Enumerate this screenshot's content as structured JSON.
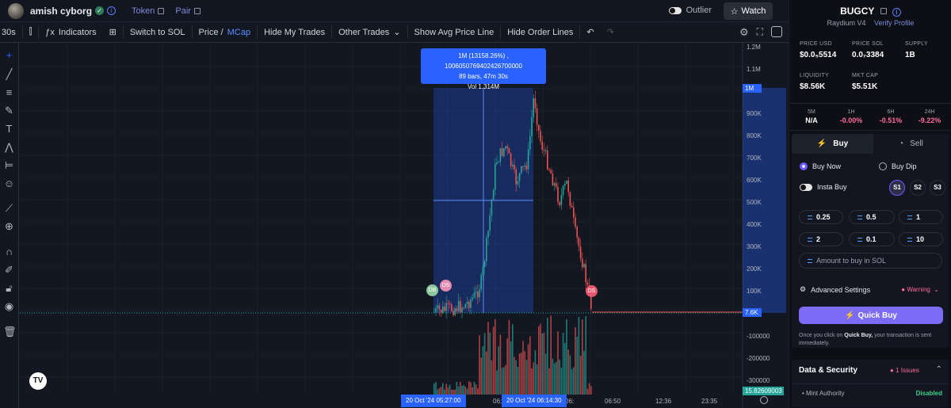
{
  "header": {
    "username": "amish cyborg",
    "token_link": "Token",
    "pair_link": "Pair",
    "outlier_label": "Outlier",
    "watch_label": "Watch"
  },
  "toolbar": {
    "interval": "30s",
    "indicators": "Indicators",
    "switch_currency": "Switch to SOL",
    "price_label": "Price /",
    "mcap_label": "MCap",
    "hide_my_trades": "Hide My Trades",
    "other_trades": "Other Trades",
    "show_avg_price": "Show Avg Price Line",
    "hide_order_lines": "Hide Order Lines"
  },
  "chart": {
    "tooltip": {
      "line1": "1M (13158.26%) , 1006050769402426700000",
      "line2": "89 bars, 47m 30s",
      "line3": "Vol 1.314M"
    },
    "price_labels": [
      "1.2M",
      "1.1M",
      "900K",
      "800K",
      "700K",
      "600K",
      "500K",
      "400K",
      "300K",
      "200K",
      "100K",
      "-100000",
      "-200000",
      "-300000"
    ],
    "price_tags": {
      "top": "1M",
      "current": "7.6K",
      "volume": "15.82609003"
    },
    "time_labels": [
      "06:",
      "06:",
      "06:50",
      "12:36",
      "23:35"
    ],
    "time_tags": [
      "20 Oct '24   05:27:00",
      "20 Oct '24   06:14:30"
    ],
    "markers": [
      "DB",
      "DS",
      "DS"
    ],
    "colors": {
      "up": "#26a69a",
      "down": "#ef5350",
      "selection": "#2962ff"
    }
  },
  "panel": {
    "token_name": "BUGCY",
    "dex": "Raydium V4",
    "verify": "Verify Profile",
    "stats": [
      {
        "label": "PRICE USD",
        "value": "$0.0₅5514"
      },
      {
        "label": "PRICE SOL",
        "value": "0.0₇3384"
      },
      {
        "label": "SUPPLY",
        "value": "1B"
      },
      {
        "label": "LIQUIDITY",
        "value": "$8.56K"
      },
      {
        "label": "MKT CAP",
        "value": "$5.51K"
      }
    ],
    "changes": [
      {
        "period": "5M",
        "value": "N/A",
        "color": "#ffffff"
      },
      {
        "period": "1H",
        "value": "-0.00%",
        "color": "#ff6b9a"
      },
      {
        "period": "6H",
        "value": "-0.51%",
        "color": "#ff6b9a"
      },
      {
        "period": "24H",
        "value": "-9.22%",
        "color": "#ff6b9a"
      }
    ],
    "tabs": {
      "buy": "Buy",
      "sell": "Sell"
    },
    "buy_now": "Buy Now",
    "buy_dip": "Buy Dip",
    "insta_buy": "Insta Buy",
    "slots": [
      "S1",
      "S2",
      "S3"
    ],
    "amounts": [
      "0.25",
      "0.5",
      "1",
      "2",
      "0.1",
      "10"
    ],
    "amount_placeholder": "Amount to buy in SOL",
    "advanced": "Advanced Settings",
    "warning": "Warning",
    "quick_buy": "Quick Buy",
    "note_pre": "Once you click on",
    "note_bold": "Quick Buy,",
    "note_post": "your transaction is sent immediately.",
    "security_title": "Data & Security",
    "issues": "1 Issues",
    "mint_authority": "Mint Authority",
    "mint_value": "Disabled"
  }
}
